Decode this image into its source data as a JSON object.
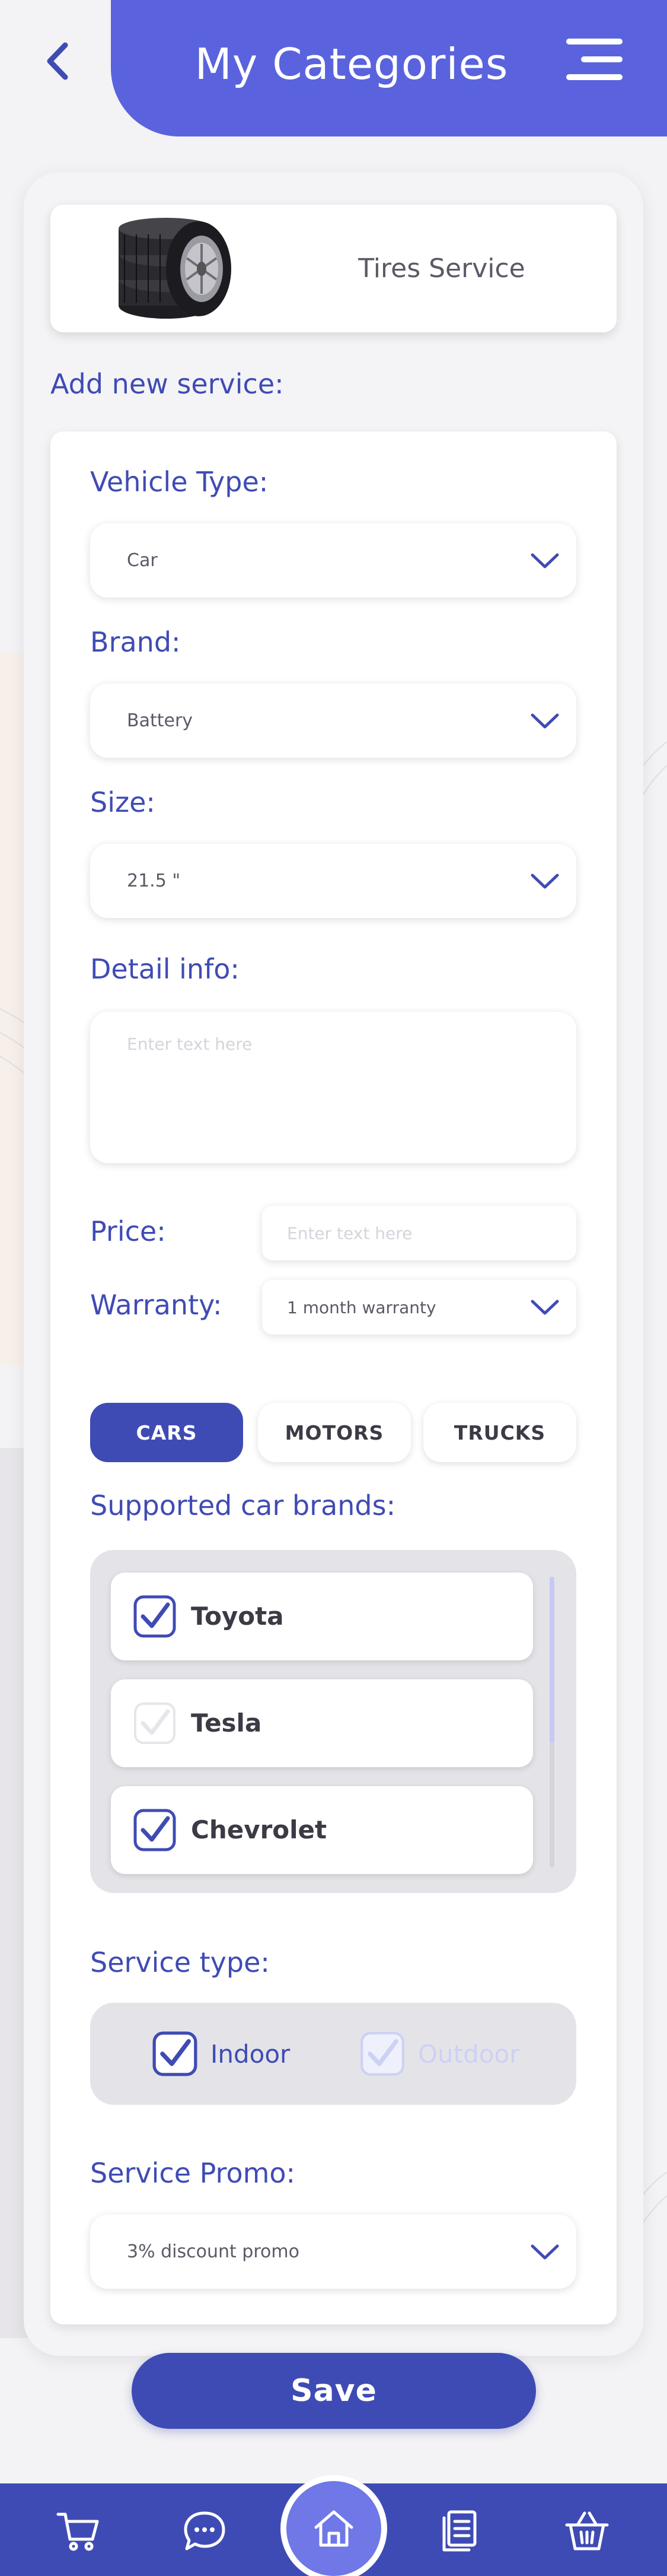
{
  "header": {
    "title": "My Categories",
    "back_icon": "chevron-left-icon",
    "menu_icon": "hamburger-menu-icon"
  },
  "category": {
    "name": "Tires Service",
    "image": "tires-stack"
  },
  "add_section_label": "Add new service:",
  "form": {
    "vehicle_type": {
      "label": "Vehicle Type:",
      "value": "Car"
    },
    "brand": {
      "label": "Brand:",
      "value": "Battery"
    },
    "size": {
      "label": "Size:",
      "value": "21.5 \""
    },
    "detail": {
      "label": "Detail info:",
      "placeholder": "Enter text here"
    },
    "price": {
      "label": "Price:",
      "placeholder": "Enter text here"
    },
    "warranty": {
      "label": "Warranty:",
      "value": "1 month warranty"
    }
  },
  "vehicle_tabs": [
    {
      "label": "CARS",
      "active": true
    },
    {
      "label": "MOTORS",
      "active": false
    },
    {
      "label": "TRUCKS",
      "active": false
    }
  ],
  "supported_brands": {
    "label": "Supported car brands:",
    "items": [
      {
        "name": "Toyota",
        "checked": true
      },
      {
        "name": "Tesla",
        "checked": false
      },
      {
        "name": "Chevrolet",
        "checked": true
      }
    ]
  },
  "service_type": {
    "label": "Service type:",
    "options": [
      {
        "label": "Indoor",
        "checked": true
      },
      {
        "label": "Outdoor",
        "checked": false
      }
    ]
  },
  "service_promo": {
    "label": "Service Promo:",
    "value": "3% discount promo"
  },
  "save_label": "Save",
  "bottom_nav": {
    "items": [
      "cart-icon",
      "chat-icon",
      "home-icon",
      "documents-icon",
      "basket-icon"
    ]
  },
  "colors": {
    "primary": "#3f4bb4",
    "header": "#5a63dd",
    "home_button": "#6f78e6"
  }
}
